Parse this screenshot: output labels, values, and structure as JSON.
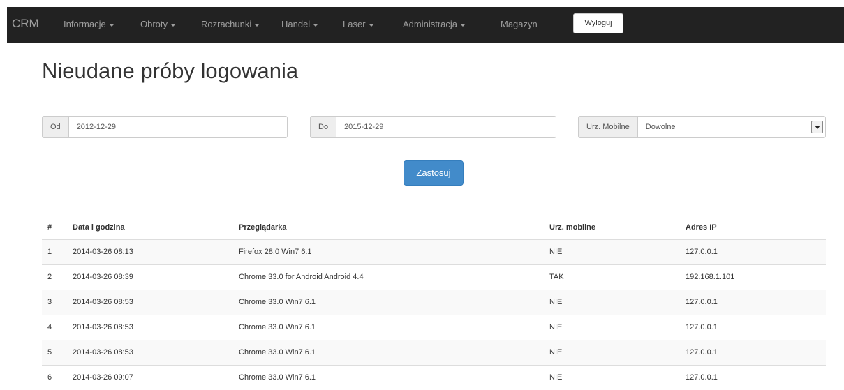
{
  "navbar": {
    "brand": "CRM",
    "items": [
      {
        "label": "Informacje",
        "dropdown": true
      },
      {
        "label": "Obroty",
        "dropdown": true
      },
      {
        "label": "Rozrachunki",
        "dropdown": true
      },
      {
        "label": "Handel",
        "dropdown": true
      },
      {
        "label": "Laser",
        "dropdown": true
      },
      {
        "label": "Administracja",
        "dropdown": true
      },
      {
        "label": "Magazyn",
        "dropdown": false
      }
    ],
    "logout_label": "Wyloguj"
  },
  "page": {
    "title": "Nieudane próby logowania"
  },
  "filters": {
    "from": {
      "label": "Od",
      "value": "2012-12-29"
    },
    "to": {
      "label": "Do",
      "value": "2015-12-29"
    },
    "mobile": {
      "label": "Urz. Mobilne",
      "value": "Dowolne"
    },
    "apply_label": "Zastosuj"
  },
  "table": {
    "headers": [
      "#",
      "Data i godzina",
      "Przeglądarka",
      "Urz. mobilne",
      "Adres IP"
    ],
    "rows": [
      [
        "1",
        "2014-03-26 08:13",
        "Firefox 28.0 Win7 6.1",
        "NIE",
        "127.0.0.1"
      ],
      [
        "2",
        "2014-03-26 08:39",
        "Chrome 33.0 for Android Android 4.4",
        "TAK",
        "192.168.1.101"
      ],
      [
        "3",
        "2014-03-26 08:53",
        "Chrome 33.0 Win7 6.1",
        "NIE",
        "127.0.0.1"
      ],
      [
        "4",
        "2014-03-26 08:53",
        "Chrome 33.0 Win7 6.1",
        "NIE",
        "127.0.0.1"
      ],
      [
        "5",
        "2014-03-26 08:53",
        "Chrome 33.0 Win7 6.1",
        "NIE",
        "127.0.0.1"
      ],
      [
        "6",
        "2014-03-26 09:07",
        "Chrome 33.0 Win7 6.1",
        "NIE",
        "127.0.0.1"
      ]
    ]
  },
  "colors": {
    "navbar_bg": "#222222",
    "nav_text": "#9d9d9d",
    "primary": "#428bca"
  }
}
